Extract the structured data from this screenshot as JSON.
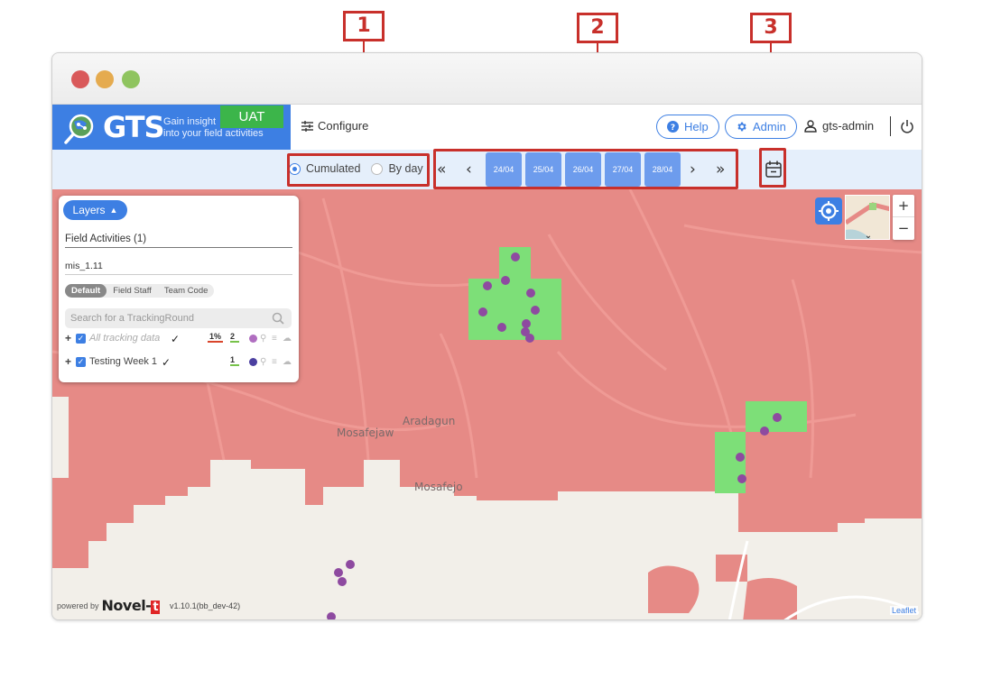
{
  "callouts": [
    "1",
    "2",
    "3"
  ],
  "window": {
    "traffic_lights": {
      "close": "#d9595a",
      "minimize": "#e5ab4f",
      "maximize": "#8fc45f"
    }
  },
  "header": {
    "brand": {
      "name": "GTS",
      "tagline_line1": "Gain insight",
      "tagline_line2": "into your field activities",
      "env_badge": "UAT",
      "logo_icon": "globe-magnifier-icon"
    },
    "configure_label": "Configure",
    "help_label": "Help",
    "admin_label": "Admin",
    "username": "gts-admin",
    "logout_icon": "power-icon"
  },
  "toolbar": {
    "mode_options": [
      {
        "label": "Cumulated",
        "selected": true
      },
      {
        "label": "By day",
        "selected": false
      }
    ],
    "nav": {
      "first": "«",
      "prev": "‹",
      "next": "›",
      "last": "»"
    },
    "dates": [
      "24/04",
      "25/04",
      "26/04",
      "27/04",
      "28/04"
    ],
    "calendar_icon": "calendar-icon"
  },
  "layers_panel": {
    "toggle_label": "Layers",
    "field_activities": "Field Activities (1)",
    "selected_item": "mis_1.11",
    "group_by_options": [
      {
        "label": "Default",
        "active": true
      },
      {
        "label": "Field Staff",
        "active": false
      },
      {
        "label": "Team Code",
        "active": false
      }
    ],
    "search_placeholder": "Search for a TrackingRound",
    "rows": [
      {
        "name": "All tracking data",
        "checked": true,
        "italic": true,
        "percent": "1%",
        "count": "2",
        "color": "#b06ec0"
      },
      {
        "name": "Testing Week 1",
        "checked": true,
        "italic": false,
        "percent": "",
        "count": "1",
        "color": "#4b3fa0"
      }
    ]
  },
  "map": {
    "labels": [
      "Aradagun",
      "Mosafejaw",
      "Mosafejo"
    ],
    "coverage_color": "#e68a86",
    "visited_color": "#7ddf78",
    "point_color": "#8e4aa0",
    "zoom_in": "+",
    "zoom_out": "−"
  },
  "footer": {
    "powered_by": "powered by",
    "vendor": "Novel-",
    "vendor_mark": "t",
    "version": "v1.10.1(bb_dev-42)",
    "attribution": "Leaflet"
  }
}
